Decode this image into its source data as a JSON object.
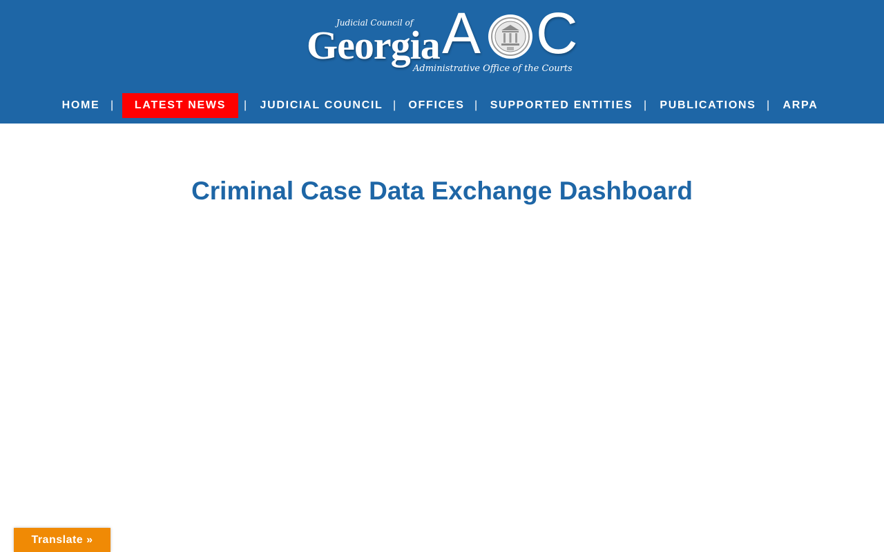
{
  "logo": {
    "small_top": "Judicial Council of",
    "georgia": "Georgia",
    "a": "A",
    "c": "C",
    "tagline": "Administrative Office of the Courts"
  },
  "nav": {
    "items": [
      {
        "label": "HOME"
      },
      {
        "label": "LATEST NEWS"
      },
      {
        "label": "JUDICIAL COUNCIL"
      },
      {
        "label": "OFFICES"
      },
      {
        "label": "SUPPORTED ENTITIES"
      },
      {
        "label": "PUBLICATIONS"
      },
      {
        "label": "ARPA"
      }
    ],
    "separator": "|"
  },
  "main": {
    "title": "Criminal Case Data Exchange Dashboard"
  },
  "translate": {
    "label": "Translate »"
  },
  "colors": {
    "header_bg": "#1e66a6",
    "active_nav_bg": "#ff0000",
    "title": "#1e66a6",
    "translate_bg": "#f08a05"
  }
}
